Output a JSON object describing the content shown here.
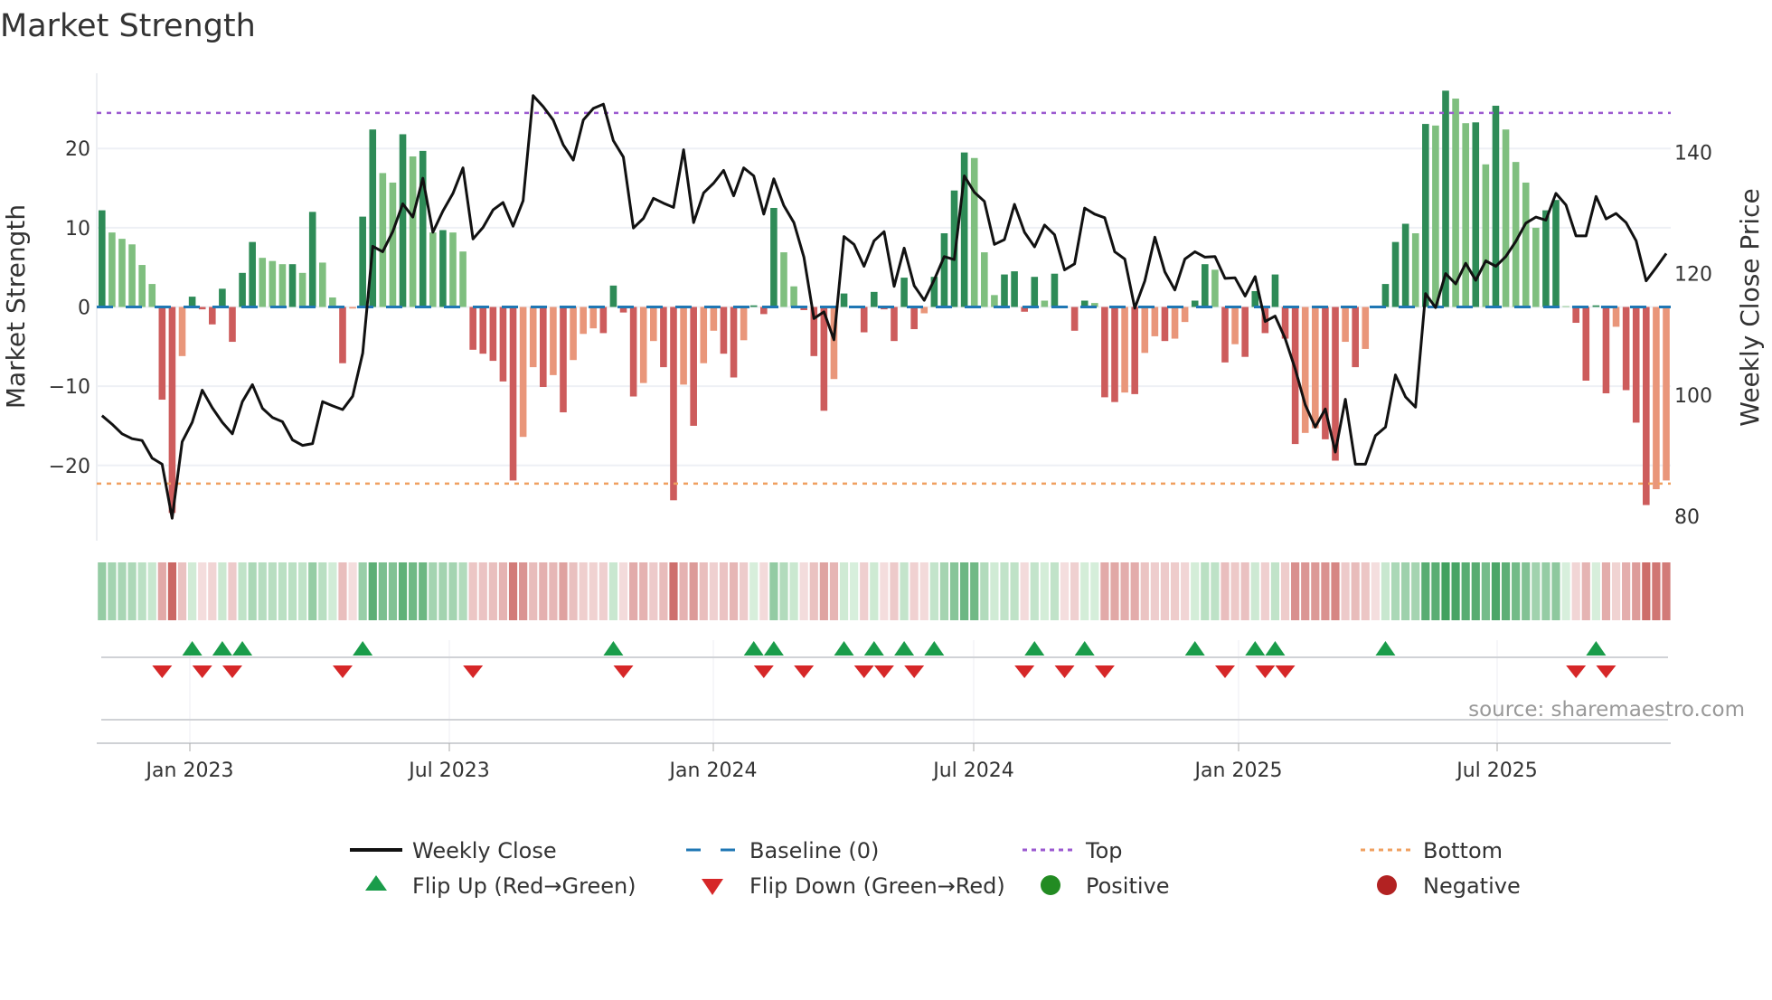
{
  "title": "Market Strength",
  "source": "source: sharemaestro.com",
  "colors": {
    "up_strong": "#2e8b57",
    "up_weak": "#7fbf7f",
    "down_strong": "#cd5c5c",
    "down_weak": "#e9967a",
    "baseline": "#1f77b4",
    "top": "#9b59d0",
    "bottom": "#f0a060",
    "flip_up": "#1a9c4a",
    "flip_down": "#d62728",
    "positive": "#228b22",
    "negative": "#b22222"
  },
  "chart_data": {
    "type": "bar+line",
    "title": "Market Strength",
    "ylabel": "Market Strength",
    "y2label": "Weekly Close Price",
    "ylim": [
      -29.5,
      29.5
    ],
    "y2lim": [
      76,
      153
    ],
    "yticks": [
      "20",
      "10",
      "0",
      "−10",
      "−20"
    ],
    "y2ticks": [
      "140",
      "120",
      "100",
      "80"
    ],
    "xticks": [
      "Jan 2023",
      "Jul 2023",
      "Jan 2024",
      "Jul 2024",
      "Jan 2025",
      "Jul 2025"
    ],
    "top_level": 24.5,
    "bottom_level": -22.3,
    "strength": [
      12.2,
      9.4,
      8.6,
      7.9,
      5.3,
      2.9,
      -11.7,
      -26,
      -6.2,
      1.3,
      -0.3,
      -2.2,
      2.3,
      -4.4,
      4.3,
      8.2,
      6.2,
      5.8,
      5.4,
      5.4,
      4.3,
      12,
      5.6,
      1.2,
      -7.1,
      -0.2,
      11.4,
      22.4,
      16.9,
      15.7,
      21.8,
      19,
      19.7,
      9.4,
      9.7,
      9.4,
      7,
      -5.4,
      -5.9,
      -6.8,
      -9.4,
      -21.9,
      -16.4,
      -7.6,
      -10.1,
      -8.6,
      -13.3,
      -6.7,
      -3.4,
      -2.7,
      -3.3,
      2.7,
      -0.7,
      -11.3,
      -9.6,
      -4.3,
      -7.6,
      -24.4,
      -9.8,
      -15,
      -7.1,
      -3,
      -5.9,
      -8.9,
      -4.2,
      0.2,
      -0.9,
      12.5,
      6.9,
      2.6,
      -0.4,
      -6.2,
      -13.1,
      -9.1,
      1.7,
      0.1,
      -3.2,
      1.9,
      -0.3,
      -4.3,
      3.7,
      -2.8,
      -0.8,
      3.8,
      9.3,
      14.7,
      19.5,
      18.8,
      6.9,
      1.5,
      4.1,
      4.5,
      -0.6,
      3.8,
      0.8,
      4.2,
      -0.1,
      -3,
      0.8,
      0.5,
      -11.4,
      -12,
      -10.8,
      -11,
      -5.8,
      -3.7,
      -4.3,
      -4,
      -1.9,
      0.8,
      5.4,
      4.7,
      -7,
      -4.7,
      -6.3,
      2,
      -3.3,
      4.1,
      -4,
      -17.3,
      -15.9,
      -15.3,
      -16.7,
      -19.4,
      -4.4,
      -7.6,
      -5.3,
      -0.1,
      2.9,
      8.2,
      10.5,
      9.3,
      23.1,
      22.9,
      27.3,
      26.3,
      23.2,
      23.3,
      18,
      25.4,
      22.4,
      18.3,
      15.7,
      10,
      12.2,
      13.5,
      0.1,
      -2,
      -9.3,
      0.2,
      -10.9,
      -2.5,
      -10.5,
      -14.6,
      -25,
      -23,
      -21.9
    ],
    "weekly_close": [
      96.6,
      95.2,
      93.6,
      92.8,
      92.5,
      89.6,
      88.6,
      79.7,
      92.3,
      95.5,
      100.8,
      97.9,
      95.5,
      93.6,
      98.9,
      101.7,
      97.8,
      96.3,
      95.6,
      92.6,
      91.7,
      92,
      98.9,
      98.2,
      97.6,
      99.8,
      106.9,
      124.5,
      123.6,
      126.9,
      131.5,
      129.3,
      135.7,
      126.8,
      130.3,
      133.2,
      137.4,
      125.7,
      127.6,
      130.5,
      131.7,
      127.8,
      132,
      149.3,
      147.5,
      145.3,
      141.2,
      138.7,
      145.3,
      147.2,
      147.9,
      141.9,
      139.2,
      127.5,
      129.1,
      132.4,
      131.6,
      130.9,
      140.4,
      128.4,
      133.3,
      134.9,
      137,
      132.8,
      137.4,
      136.1,
      129.8,
      135.6,
      131.2,
      128.4,
      122.7,
      112.6,
      113.7,
      109.1,
      126.1,
      124.8,
      121.2,
      125.4,
      126.9,
      117.9,
      124.2,
      118,
      115.6,
      119,
      122.8,
      122.3,
      136.1,
      133.4,
      131.9,
      124.8,
      125.6,
      131.4,
      126.8,
      124.4,
      128,
      126.4,
      120.6,
      121.6,
      130.8,
      129.8,
      129.2,
      123.6,
      122.4,
      114.3,
      118.8,
      126,
      120.3,
      117.3,
      122.4,
      123.6,
      122.7,
      122.8,
      119.2,
      119.3,
      116.3,
      119.5,
      112.1,
      113,
      109.3,
      104.3,
      98.4,
      94.7,
      97.7,
      90.6,
      99.3,
      88.6,
      88.6,
      93.3,
      94.7,
      103.3,
      99.7,
      98,
      116.7,
      114.4,
      120,
      118.3,
      121.7,
      118.9,
      122.1,
      121.2,
      122.8,
      125.3,
      128.3,
      129.3,
      128.8,
      133.2,
      131.3,
      126.2,
      126.2,
      132.7,
      129,
      129.9,
      128.4,
      125.4,
      118.8,
      121,
      123.3
    ],
    "legend": {
      "weekly_close": "Weekly Close",
      "baseline": "Baseline (0)",
      "top": "Top",
      "bottom": "Bottom",
      "flip_up": "Flip Up (Red→Green)",
      "flip_down": "Flip Down (Green→Red)",
      "positive": "Positive",
      "negative": "Negative"
    }
  }
}
